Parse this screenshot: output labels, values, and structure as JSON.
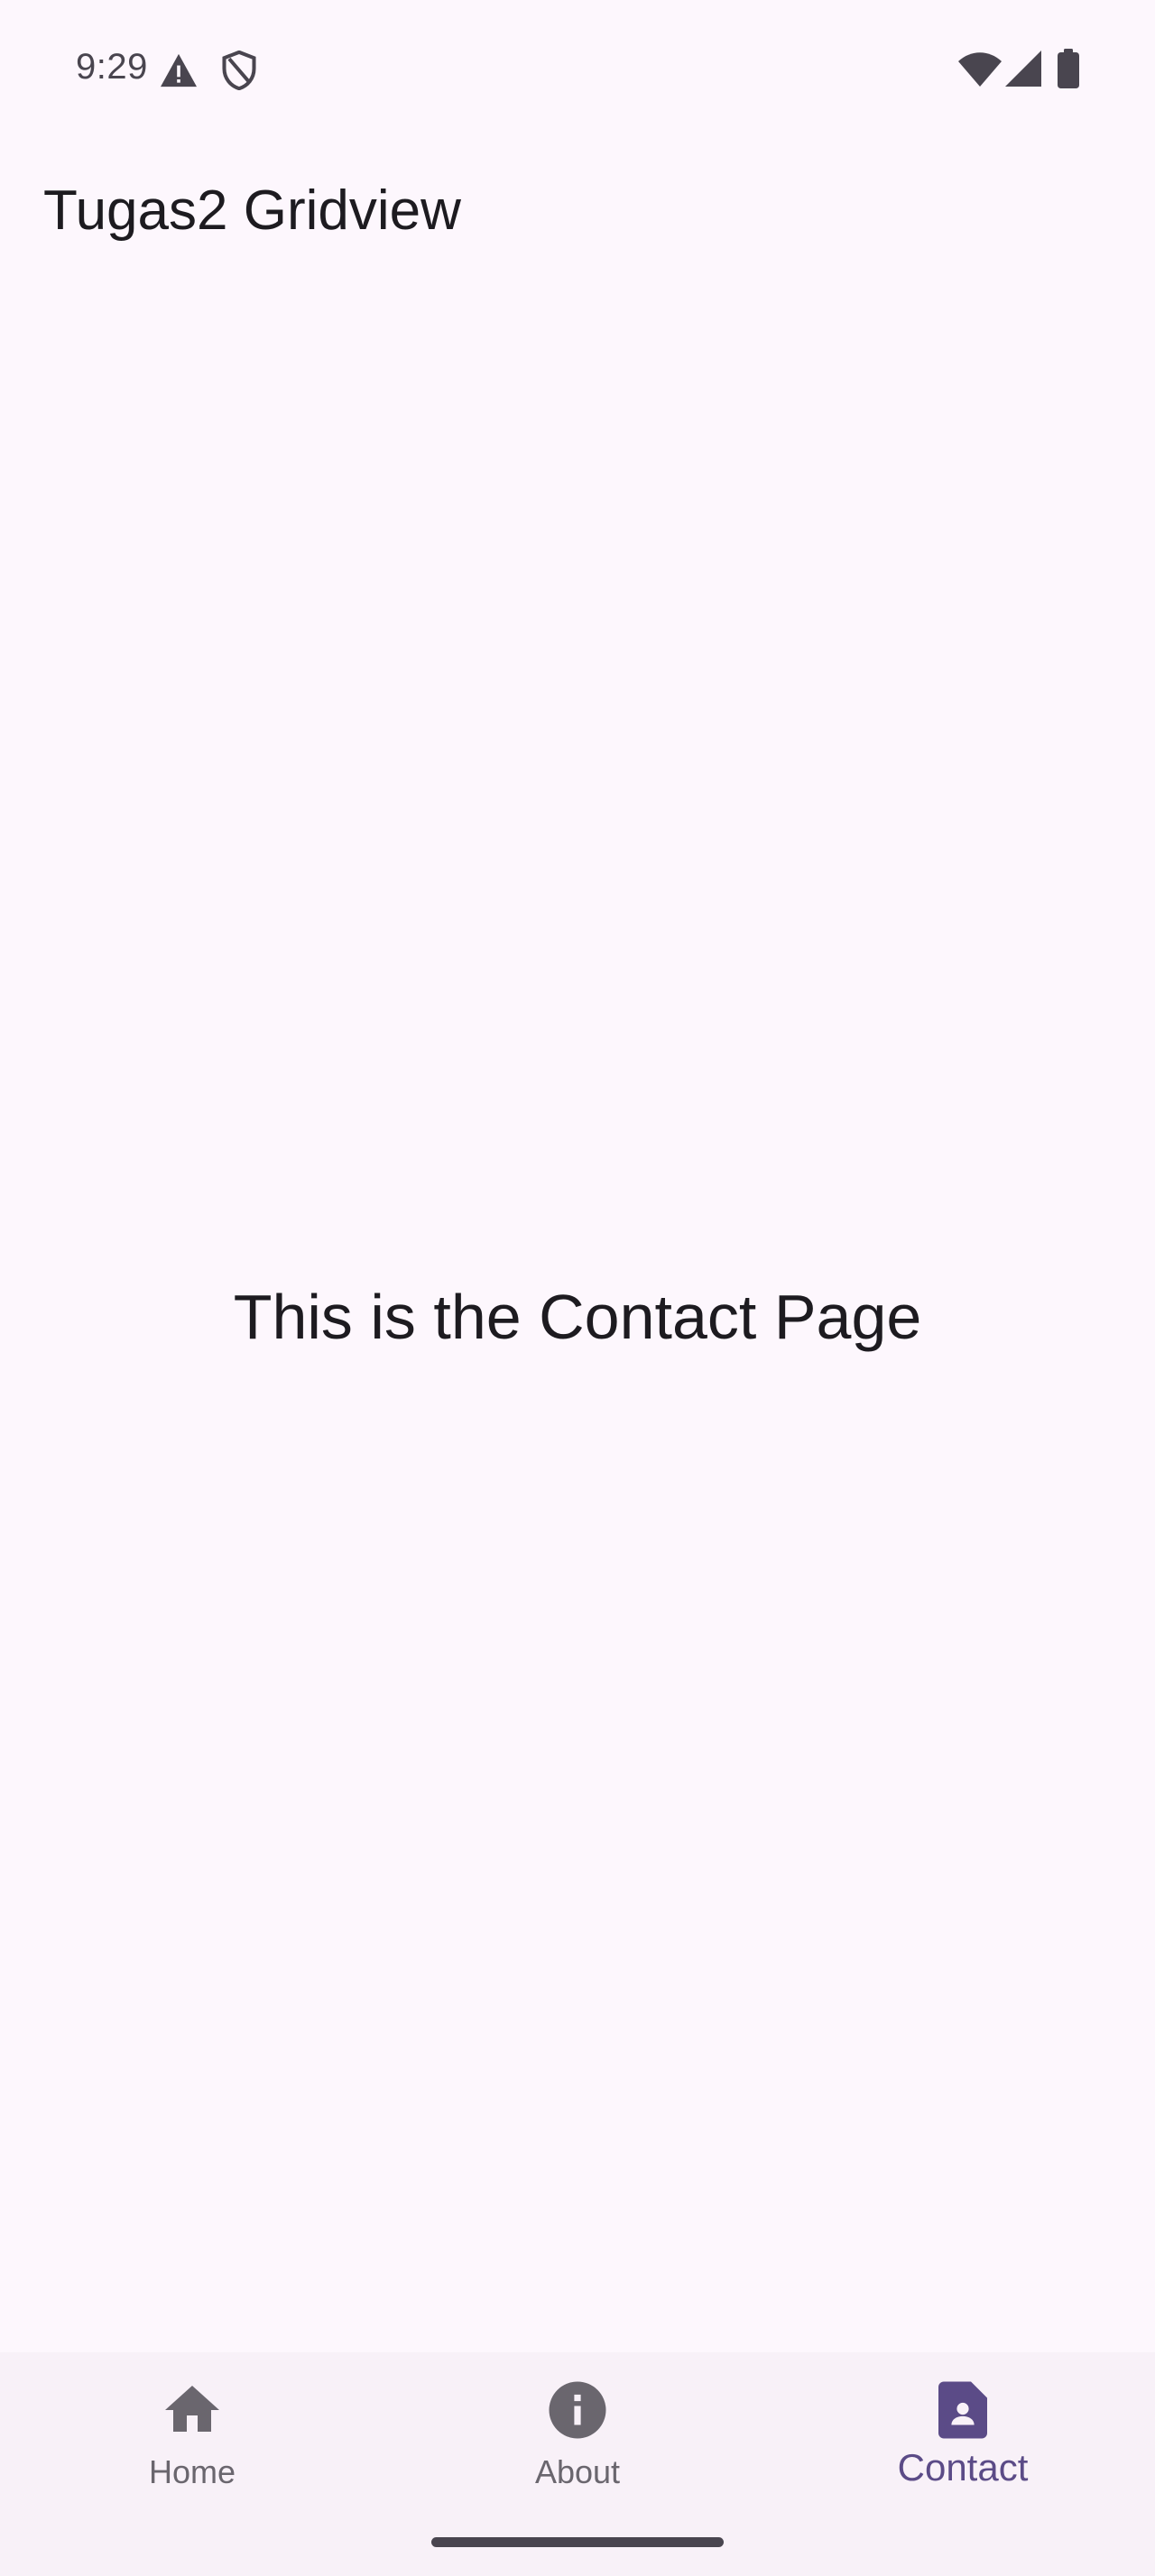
{
  "status_bar": {
    "time": "9:29",
    "left_icons": [
      "warning-icon",
      "shield-icon"
    ],
    "right_icons": [
      "wifi-icon",
      "cellular-icon",
      "battery-icon"
    ]
  },
  "app_bar": {
    "title": "Tugas2 Gridview"
  },
  "content": {
    "message": "This is the Contact Page"
  },
  "bottom_nav": {
    "items": [
      {
        "label": "Home",
        "icon": "home-icon",
        "active": false
      },
      {
        "label": "About",
        "icon": "info-icon",
        "active": false
      },
      {
        "label": "Contact",
        "icon": "contact-page-icon",
        "active": true
      }
    ]
  },
  "colors": {
    "background": "#fdf7fd",
    "nav_background": "#f8f1f8",
    "text_primary": "#1d1b20",
    "icon_inactive": "#6a666e",
    "accent": "#5b4b87"
  }
}
